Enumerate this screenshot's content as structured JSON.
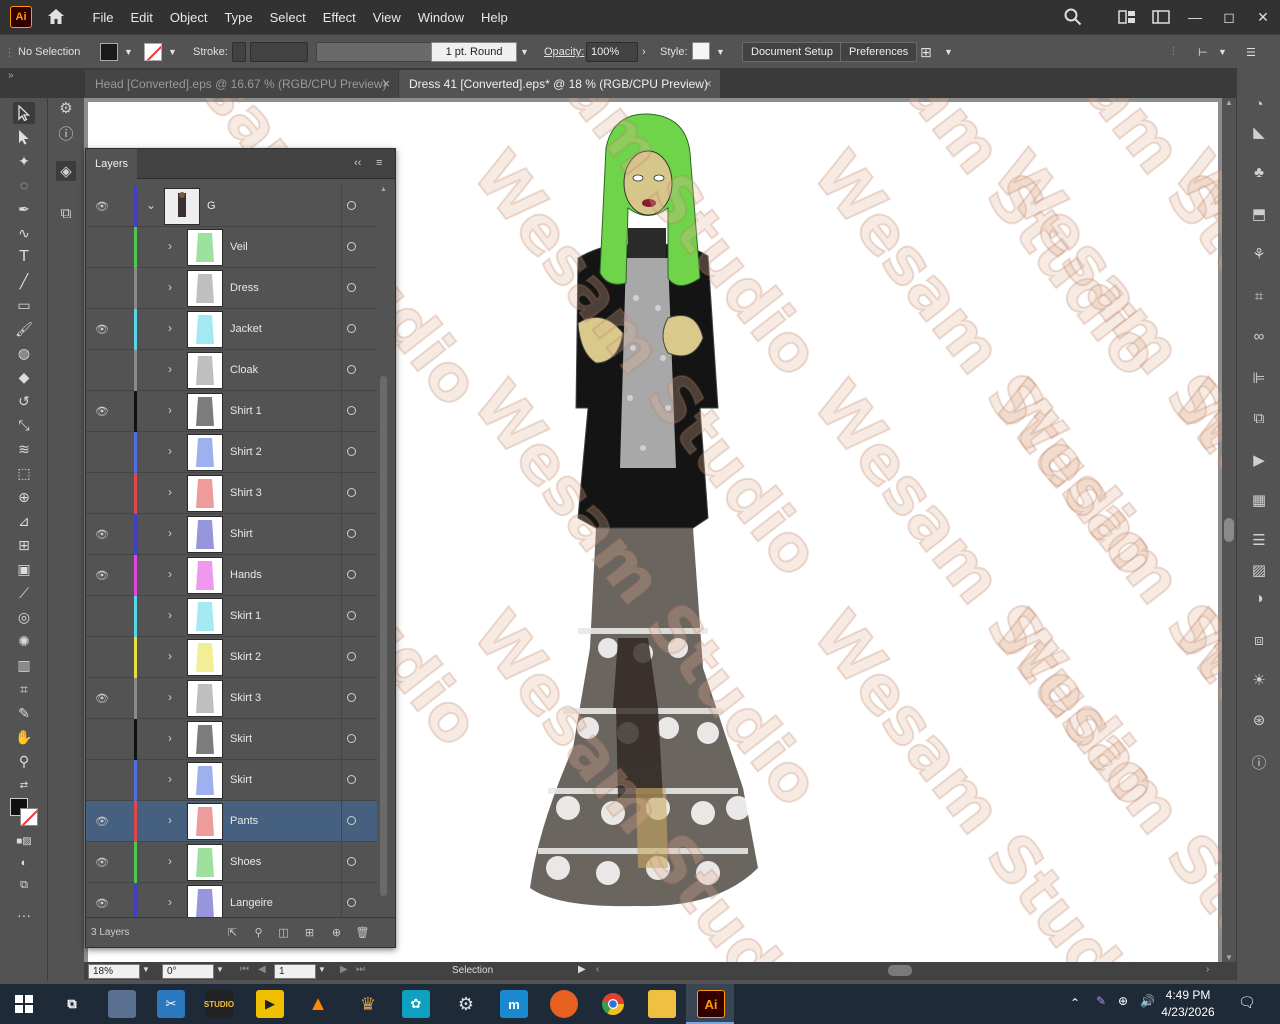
{
  "app": {
    "logo": "Ai"
  },
  "menu": [
    "File",
    "Edit",
    "Object",
    "Type",
    "Select",
    "Effect",
    "View",
    "Window",
    "Help"
  ],
  "control": {
    "selection": "No Selection",
    "stroke_label": "Stroke:",
    "brush": "1 pt. Round",
    "opacity_label": "Opacity:",
    "opacity_value": "100%",
    "style_label": "Style:",
    "doc_setup": "Document Setup",
    "preferences": "Preferences"
  },
  "tabs": [
    {
      "label": "Head [Converted].eps @ 16.67 % (RGB/CPU Preview)",
      "close": "×"
    },
    {
      "label": "Dress 41 [Converted].eps* @ 18 % (RGB/CPU Preview)",
      "close": "×"
    }
  ],
  "layers_panel": {
    "title": "Layers",
    "collapse": "‹‹",
    "menu": "≡",
    "parent_name": "G",
    "footer_count": "3 Layers",
    "rows": [
      {
        "name": "Veil",
        "visible": false,
        "color": "#4fc74f"
      },
      {
        "name": "Dress",
        "visible": false,
        "color": "#8a8a8a"
      },
      {
        "name": "Jacket",
        "visible": true,
        "color": "#58d6e8"
      },
      {
        "name": "Cloak",
        "visible": false,
        "color": "#8a8a8a"
      },
      {
        "name": "Shirt 1",
        "visible": true,
        "color": "#111111"
      },
      {
        "name": "Shirt 2",
        "visible": false,
        "color": "#4f6fe0"
      },
      {
        "name": "Shirt 3",
        "visible": false,
        "color": "#e04848"
      },
      {
        "name": "Shirt",
        "visible": true,
        "color": "#4040c0"
      },
      {
        "name": "Hands",
        "visible": true,
        "color": "#e046e0"
      },
      {
        "name": "Skirt 1",
        "visible": false,
        "color": "#58d6e8"
      },
      {
        "name": "Skirt 2",
        "visible": false,
        "color": "#e8e040"
      },
      {
        "name": "Skirt 3",
        "visible": true,
        "color": "#8a8a8a"
      },
      {
        "name": "Skirt",
        "visible": false,
        "color": "#111111"
      },
      {
        "name": "Skirt",
        "visible": false,
        "color": "#4f6fe0"
      },
      {
        "name": "Pants",
        "visible": true,
        "color": "#e04848",
        "selected": true
      },
      {
        "name": "Shoes",
        "visible": true,
        "color": "#4fc74f"
      },
      {
        "name": "Langeire",
        "visible": true,
        "color": "#4040c0"
      }
    ]
  },
  "watermark": "Wesam Studio",
  "status": {
    "zoom": "18%",
    "rotation": "0°",
    "artboard": "1",
    "tool": "Selection"
  },
  "taskbar": {
    "time": "4:49 PM",
    "date": "4/23/2026"
  }
}
